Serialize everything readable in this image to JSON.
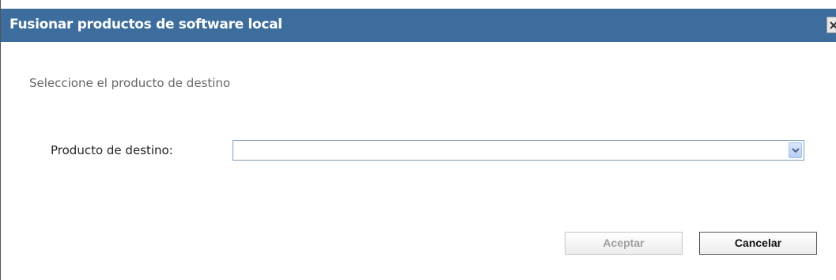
{
  "dialog": {
    "title": "Fusionar productos de software local",
    "close_icon": "close-icon",
    "instruction": "Seleccione el producto de destino",
    "target_product": {
      "label": "Producto de destino:",
      "value": "",
      "dropdown_icon": "chevron-down-icon"
    },
    "buttons": {
      "accept_label": "Aceptar",
      "accept_enabled": false,
      "cancel_label": "Cancelar"
    }
  },
  "colors": {
    "titlebar": "#3d6d9c",
    "title_text": "#ffffff",
    "instruction_text": "#666666",
    "select_border": "#7f9db9",
    "disabled_text": "#a0a0a0"
  }
}
